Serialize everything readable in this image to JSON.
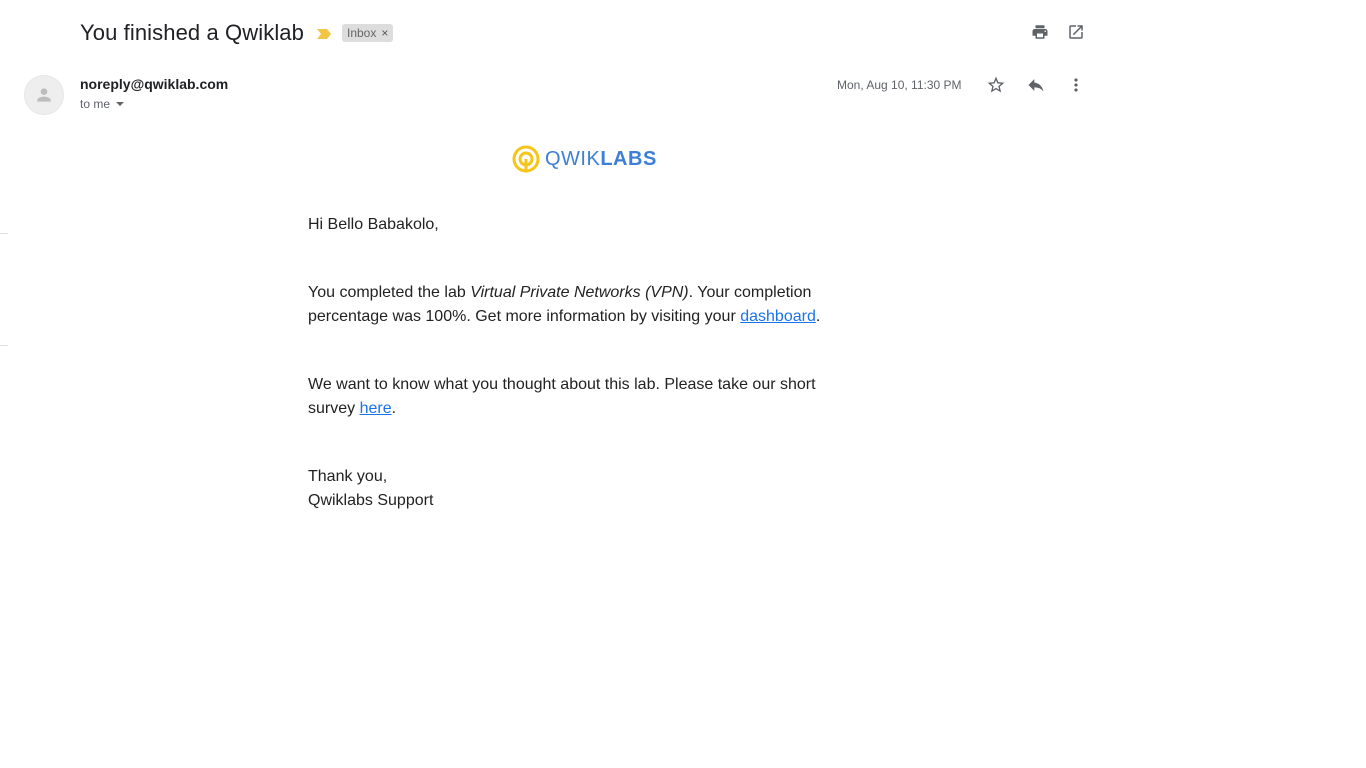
{
  "email": {
    "subject": "You finished a Qwiklab",
    "label": "Inbox",
    "label_remove": "×",
    "sender": "noreply@qwiklab.com",
    "recipient": "to me",
    "date": "Mon, Aug 10, 11:30 PM"
  },
  "icons": {
    "print": "print-icon",
    "open_new_window": "open-in-new-window-icon",
    "star": "star-icon",
    "reply": "reply-icon",
    "more": "more-vertical-icon",
    "importance": "importance-marker-icon",
    "avatar": "person-icon"
  },
  "colors": {
    "importance": "#f4c542",
    "logo_yellow": "#f5c518",
    "logo_blue": "#3d7fd6",
    "link": "#1a73e8"
  },
  "logo": {
    "light": "QWIK",
    "bold": "LABS"
  },
  "body": {
    "greeting": "Hi Bello Babakolo,",
    "p1_before": "You completed the lab ",
    "p1_lab_name": "Virtual Private Networks (VPN)",
    "p1_after": ". Your completion percentage was 100%. Get more information by visiting your ",
    "p1_link": "dashboard",
    "p1_end": ".",
    "p2_before": "We want to know what you thought about this lab. Please take our short survey ",
    "p2_link": "here",
    "p2_end": ".",
    "closing": "Thank you,",
    "signature": "Qwiklabs Support"
  }
}
